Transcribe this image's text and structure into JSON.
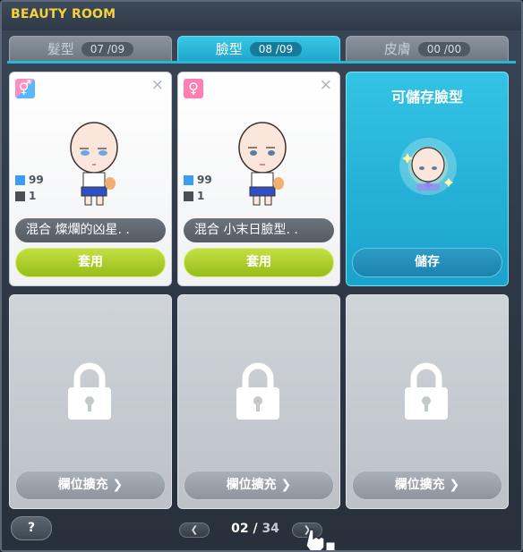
{
  "window": {
    "title": "BEAUTY ROOM"
  },
  "tabs": [
    {
      "label": "髮型",
      "count": "07 /09",
      "active": false
    },
    {
      "label": "臉型",
      "count": "08 /09",
      "active": true
    },
    {
      "label": "皮膚",
      "count": "00 /00",
      "active": false
    }
  ],
  "slots": [
    {
      "type": "face",
      "gender": "mixed",
      "gender_symbol": "⚥",
      "stat1": "99",
      "stat2": "1",
      "name": "混合  燦爛的凶星. .",
      "button": "套用"
    },
    {
      "type": "face",
      "gender": "female",
      "gender_symbol": "♀",
      "stat1": "99",
      "stat2": "1",
      "name": "混合  小末日臉型. .",
      "button": "套用"
    },
    {
      "type": "save",
      "title": "可儲存臉型",
      "button": "儲存"
    },
    {
      "type": "locked",
      "button": "欄位擴充 ❯"
    },
    {
      "type": "locked",
      "button": "欄位擴充 ❯"
    },
    {
      "type": "locked",
      "button": "欄位擴充 ❯"
    }
  ],
  "close_symbol": "×",
  "help": {
    "label": "?"
  },
  "pager": {
    "current": "02",
    "separator": "/",
    "total": "34",
    "prev": "❮",
    "next": "❯"
  },
  "colors": {
    "title": "#f4d23a",
    "active_tab": "#1ea6cd",
    "apply_button": "#95bd1a",
    "save_card": "#1aa3cc"
  }
}
